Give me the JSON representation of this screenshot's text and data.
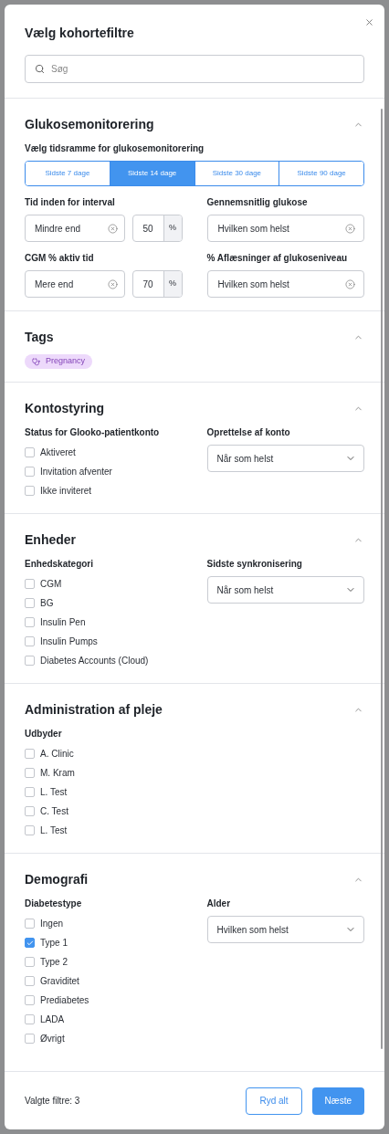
{
  "title": "Vælg kohortefiltre",
  "search": {
    "placeholder": "Søg"
  },
  "sections": [
    {
      "kind": "glucose",
      "title": "Glukosemonitorering",
      "expanded": true,
      "range_label": "Vælg tidsramme for glukosemonitorering",
      "ranges": [
        {
          "label": "Sidste 7 dage",
          "selected": false
        },
        {
          "label": "Sidste 14 dage",
          "selected": true
        },
        {
          "label": "Sidste 30 dage",
          "selected": false
        },
        {
          "label": "Sidste 90 dage",
          "selected": false
        }
      ],
      "fields": [
        {
          "kind": "threshold",
          "label": "Tid inden for interval",
          "operator": "Mindre end",
          "value": "50",
          "unit": "%"
        },
        {
          "kind": "select",
          "label": "Gennemsnitlig glukose",
          "value": "Hvilken som helst"
        },
        {
          "kind": "threshold",
          "label": "CGM % aktiv tid",
          "operator": "Mere end",
          "value": "70",
          "unit": "%"
        },
        {
          "kind": "select",
          "label": "% Aflæsninger af glukoseniveau",
          "value": "Hvilken som helst"
        }
      ]
    },
    {
      "kind": "tags",
      "title": "Tags",
      "expanded": true,
      "tags": [
        {
          "label": "Pregnancy"
        }
      ]
    },
    {
      "kind": "filters",
      "title": "Kontostyring",
      "expanded": true,
      "group": {
        "label": "Status for Glooko-patientkonto",
        "options": [
          {
            "label": "Aktiveret",
            "checked": false
          },
          {
            "label": "Invitation afventer",
            "checked": false
          },
          {
            "label": "Ikke inviteret",
            "checked": false
          }
        ]
      },
      "dropdown": {
        "label": "Oprettelse af konto",
        "value": "Når som helst"
      }
    },
    {
      "kind": "filters",
      "title": "Enheder",
      "expanded": true,
      "group": {
        "label": "Enhedskategori",
        "options": [
          {
            "label": "CGM",
            "checked": false
          },
          {
            "label": "BG",
            "checked": false
          },
          {
            "label": "Insulin Pen",
            "checked": false
          },
          {
            "label": "Insulin Pumps",
            "checked": false
          },
          {
            "label": "Diabetes Accounts (Cloud)",
            "checked": false
          }
        ]
      },
      "dropdown": {
        "label": "Sidste synkronisering",
        "value": "Når som helst"
      }
    },
    {
      "kind": "filters",
      "title": "Administration af pleje",
      "expanded": true,
      "group": {
        "label": "Udbyder",
        "options": [
          {
            "label": "A. Clinic",
            "checked": false
          },
          {
            "label": "M. Kram",
            "checked": false
          },
          {
            "label": "L. Test",
            "checked": false
          },
          {
            "label": "C. Test",
            "checked": false
          },
          {
            "label": "L. Test",
            "checked": false
          }
        ]
      }
    },
    {
      "kind": "filters",
      "title": "Demografi",
      "expanded": true,
      "group": {
        "label": "Diabetestype",
        "options": [
          {
            "label": "Ingen",
            "checked": false
          },
          {
            "label": "Type 1",
            "checked": true
          },
          {
            "label": "Type 2",
            "checked": false
          },
          {
            "label": "Graviditet",
            "checked": false
          },
          {
            "label": "Prediabetes",
            "checked": false
          },
          {
            "label": "LADA",
            "checked": false
          },
          {
            "label": "Øvrigt",
            "checked": false
          }
        ]
      },
      "dropdown": {
        "label": "Alder",
        "value": "Hvilken som helst"
      }
    }
  ],
  "footer": {
    "count": "Valgte filtre: 3",
    "buttons": [
      {
        "kind": "secondary",
        "label": "Ryd alt"
      },
      {
        "kind": "primary",
        "label": "Næste"
      }
    ]
  }
}
